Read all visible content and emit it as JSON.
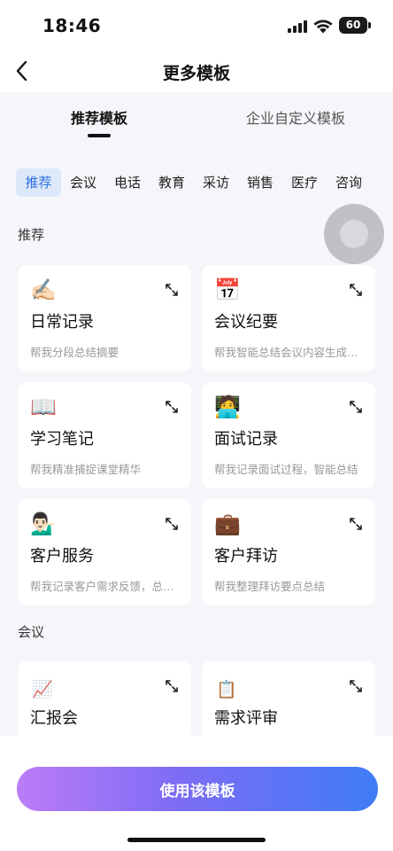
{
  "status_bar": {
    "time": "18:46",
    "battery": "60"
  },
  "nav": {
    "title": "更多模板"
  },
  "top_tabs": [
    {
      "label": "推荐模板",
      "active": true
    },
    {
      "label": "企业自定义模板",
      "active": false
    }
  ],
  "categories": [
    "推荐",
    "会议",
    "电话",
    "教育",
    "采访",
    "销售",
    "医疗",
    "咨询"
  ],
  "active_category": "推荐",
  "sections": [
    {
      "title": "推荐",
      "cards": [
        {
          "emoji": "✍🏻",
          "icon": "writing-hand-icon",
          "title": "日常记录",
          "desc": "帮我分段总结摘要"
        },
        {
          "emoji": "📅",
          "icon": "calendar-icon",
          "title": "会议纪要",
          "desc": "帮我智能总结会议内容生成纪要"
        },
        {
          "emoji": "📖",
          "icon": "open-book-icon",
          "title": "学习笔记",
          "desc": "帮我精准捕捉课堂精华"
        },
        {
          "emoji": "🧑‍💻",
          "icon": "technologist-icon",
          "title": "面试记录",
          "desc": "帮我记录面试过程，智能总结"
        },
        {
          "emoji": "💁🏻‍♂️",
          "icon": "person-tipping-hand-icon",
          "title": "客户服务",
          "desc": "帮我记录客户需求反馈，总结要点"
        },
        {
          "emoji": "💼",
          "icon": "briefcase-icon",
          "title": "客户拜访",
          "desc": "帮我整理拜访要点总结"
        }
      ]
    },
    {
      "title": "会议",
      "cards": [
        {
          "emoji": "📈",
          "icon": "chart-increasing-icon",
          "title": "汇报会",
          "desc": ""
        },
        {
          "emoji": "📋",
          "icon": "clipboard-icon",
          "title": "需求评审",
          "desc": ""
        }
      ]
    }
  ],
  "bottom": {
    "button_label": "使用该模板"
  }
}
